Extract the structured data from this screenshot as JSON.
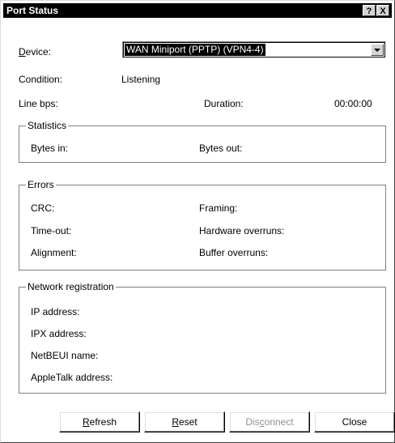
{
  "window": {
    "title": "Port Status",
    "help_label": "?",
    "close_label": "X"
  },
  "device": {
    "label": "Device:",
    "selected": "WAN Miniport (PPTP) (VPN4-4)"
  },
  "condition": {
    "label": "Condition:",
    "value": "Listening"
  },
  "line_bps": {
    "label": "Line bps:"
  },
  "duration": {
    "label": "Duration:",
    "value": "00:00:00"
  },
  "statistics": {
    "title": "Statistics",
    "bytes_in": "Bytes in:",
    "bytes_out": "Bytes out:"
  },
  "errors": {
    "title": "Errors",
    "crc": "CRC:",
    "framing": "Framing:",
    "timeout": "Time-out:",
    "hardware_overruns": "Hardware overruns:",
    "alignment": "Alignment:",
    "buffer_overruns": "Buffer overruns:"
  },
  "network": {
    "title": "Network registration",
    "ip": "IP address:",
    "ipx": "IPX address:",
    "netbeui": "NetBEUI name:",
    "appletalk": "AppleTalk address:"
  },
  "buttons": {
    "refresh": "Refresh",
    "reset": "Reset",
    "disconnect": "Disconnect",
    "close": "Close"
  }
}
